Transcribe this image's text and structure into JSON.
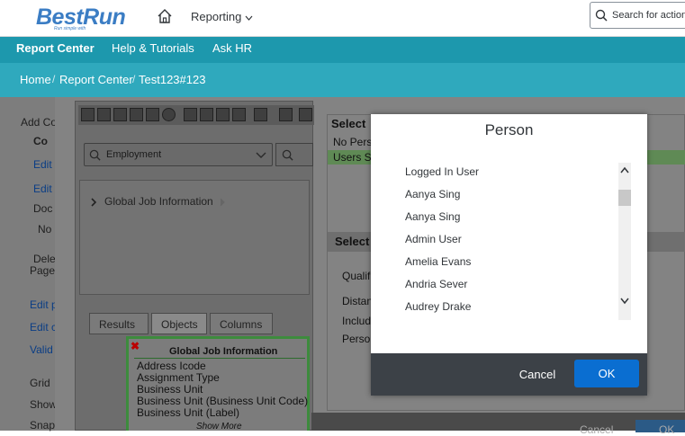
{
  "shell": {
    "logo": "BestRun",
    "logo_tagline": "Run simple with",
    "menu_label": "Reporting",
    "search_placeholder": "Search for actions"
  },
  "nav": {
    "items": [
      "Report Center",
      "Help & Tutorials",
      "Ask HR"
    ]
  },
  "breadcrumb": [
    "Home",
    "Report Center",
    "Test123#123"
  ],
  "left_pane": {
    "items": [
      "Add Co",
      "Co",
      "Edit",
      "Edit",
      "Doc",
      "No",
      "Dele",
      "Page",
      "Edit p",
      "Edit c",
      "Valid",
      "Grid",
      "Show",
      "Snap"
    ]
  },
  "query_builder": {
    "entity": "Employment",
    "tree_item": "Global Job Information",
    "tabs": [
      "Results",
      "Objects",
      "Columns"
    ],
    "field_box": {
      "header": "Global Job Information",
      "fields": [
        "Address Icode",
        "Assignment Type",
        "Business Unit",
        "Business Unit (Business Unit Code)",
        "Business Unit (Label)"
      ],
      "show_more": "Show More"
    }
  },
  "background_dialog": {
    "section1": "Select",
    "row1": "No Pers",
    "row2": "Users S",
    "section2": "Select",
    "labels": [
      "Qualifi",
      "Distan",
      "Includ",
      "Person"
    ],
    "footer_cancel": "Cancel",
    "footer_ok": "OK"
  },
  "modal": {
    "title": "Person",
    "people": [
      "Logged In User",
      "Aanya Sing",
      "Aanya Sing",
      "Admin User",
      "Amelia Evans",
      "Andria Sever",
      "Audrey Drake"
    ],
    "cancel_label": "Cancel",
    "ok_label": "OK"
  },
  "colors": {
    "nav_bg": "#1d98ad",
    "breadcrumb_bg": "#2fa9bd",
    "primary_button": "#0a6ed1",
    "modal_footer": "#3c4147"
  }
}
